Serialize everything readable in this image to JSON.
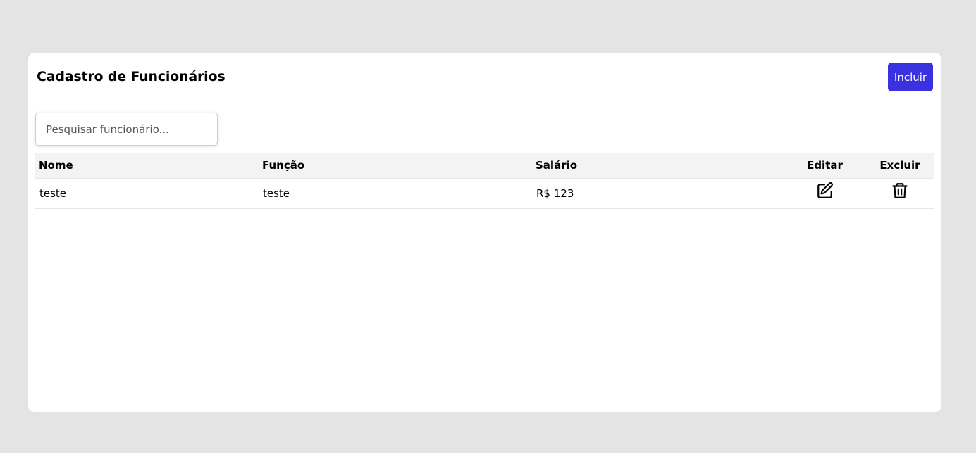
{
  "page": {
    "title": "Cadastro de Funcionários",
    "add_label": "Incluir"
  },
  "search": {
    "placeholder": "Pesquisar funcionário..."
  },
  "table": {
    "headers": {
      "name": "Nome",
      "function": "Função",
      "salary": "Salário",
      "edit": "Editar",
      "delete": "Excluir"
    },
    "rows": [
      {
        "name": "teste",
        "function": "teste",
        "salary": "R$ 123",
        "edit_icon": "edit-icon",
        "delete_icon": "trash-icon"
      }
    ]
  },
  "colors": {
    "accent": "#3a32e0",
    "background": "#e4e4e4",
    "card": "#ffffff",
    "header_row": "#f3f3f3"
  }
}
